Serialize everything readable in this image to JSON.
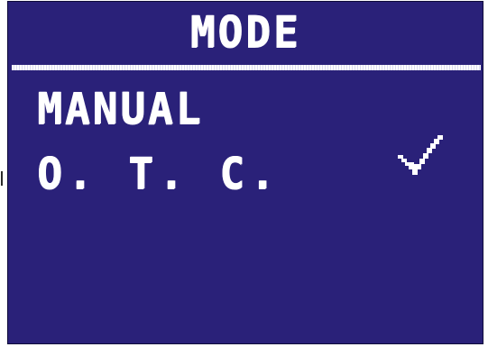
{
  "screen": {
    "title": "MODE"
  },
  "menu": {
    "items": [
      {
        "label": "MANUAL",
        "selected": false
      },
      {
        "label": "O. T. C.",
        "selected": true
      }
    ]
  },
  "colors": {
    "background": "#2a2179",
    "text": "#ffffff"
  },
  "icons": {
    "selected_indicator": "checkmark-icon"
  }
}
